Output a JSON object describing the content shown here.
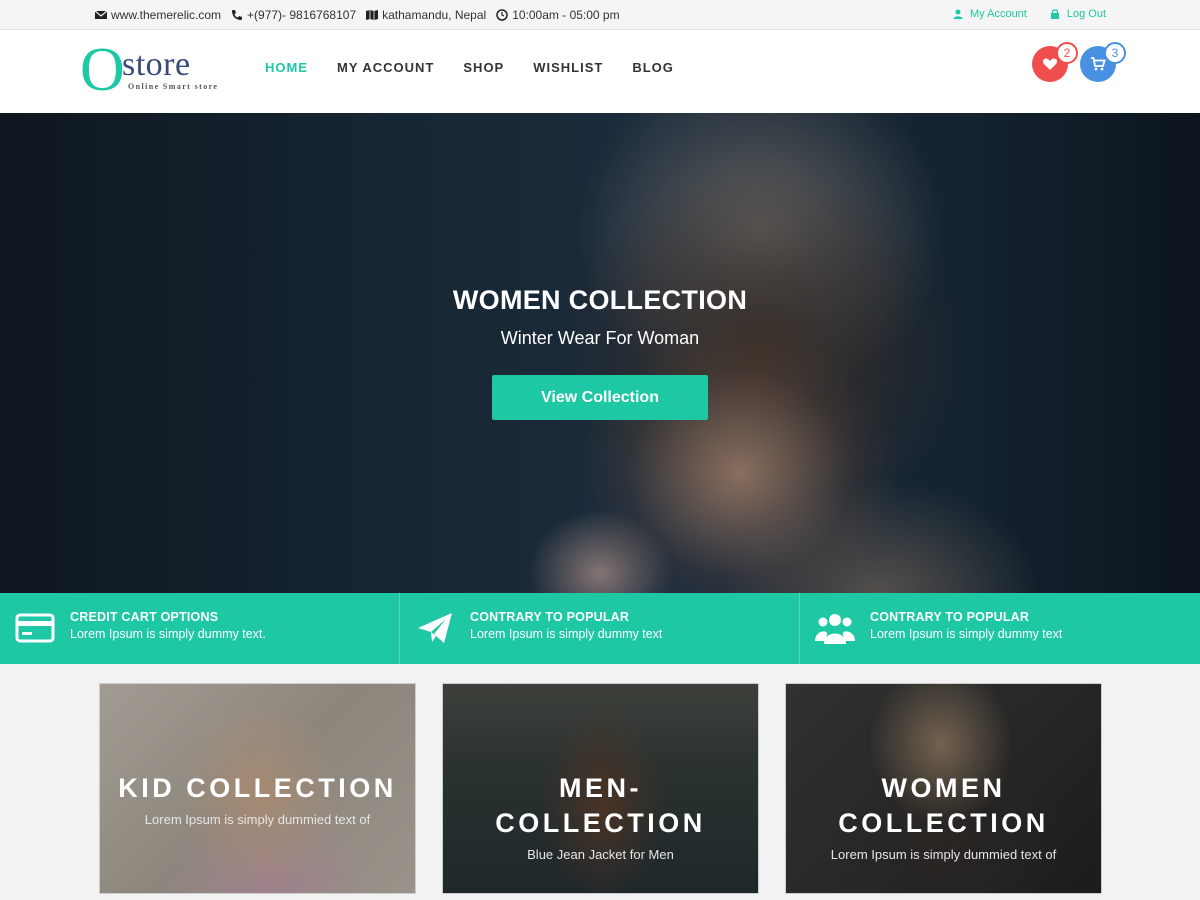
{
  "topbar": {
    "website": "www.themerelic.com",
    "phone": "+(977)- 9816768107",
    "location": "kathamandu, Nepal",
    "hours": "10:00am - 05:00 pm",
    "my_account": "My Account",
    "logout": "Log Out"
  },
  "header": {
    "logo_letter": "O",
    "logo_word": "store",
    "logo_tagline": "Online Smart store",
    "nav": [
      "HOME",
      "MY ACCOUNT",
      "SHOP",
      "WISHLIST",
      "BLOG"
    ],
    "active_nav": "HOME",
    "wishlist_count": "2",
    "cart_count": "3"
  },
  "hero": {
    "title": "WOMEN COLLECTION",
    "subtitle": "Winter Wear For Woman",
    "button": "View Collection"
  },
  "features": [
    {
      "icon": "credit-card-icon",
      "title": "CREDIT CART OPTIONS",
      "text": "Lorem Ipsum is simply dummy text."
    },
    {
      "icon": "paper-plane-icon",
      "title": "CONTRARY TO POPULAR",
      "text": "Lorem Ipsum is simply dummy text"
    },
    {
      "icon": "users-icon",
      "title": "CONTRARY TO POPULAR",
      "text": "Lorem Ipsum is simply dummy text"
    }
  ],
  "collections": [
    {
      "title_lines": [
        "KID COLLECTION"
      ],
      "text": "Lorem Ipsum is simply dummied text of"
    },
    {
      "title_lines": [
        "MEN-",
        "COLLECTION"
      ],
      "text": "Blue Jean Jacket for Men"
    },
    {
      "title_lines": [
        "WOMEN",
        "COLLECTION"
      ],
      "text": "Lorem Ipsum is simply dummied text of"
    }
  ],
  "colors": {
    "accent": "#1ec8a5",
    "wishlist": "#f04e4e",
    "cart": "#4a90e2",
    "nav_text": "#333333"
  }
}
